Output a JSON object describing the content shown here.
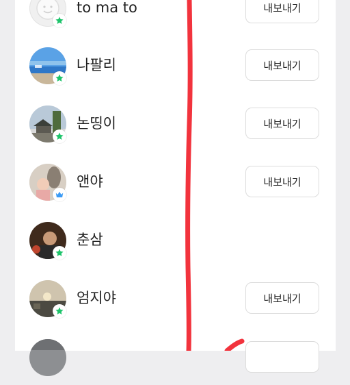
{
  "colors": {
    "background": "#eeeef0",
    "panel": "#ffffff",
    "badge_green": "#1ec46b",
    "badge_blue": "#3b9bf5",
    "annotation_red": "#f2333d"
  },
  "friends": [
    {
      "name": "to ma to",
      "badge": "star-green",
      "export_label": "내보내기"
    },
    {
      "name": "나팔리",
      "badge": "star-green",
      "export_label": "내보내기"
    },
    {
      "name": "논띵이",
      "badge": "star-green",
      "export_label": "내보내기"
    },
    {
      "name": "앤야",
      "badge": "crown-blue",
      "export_label": "내보내기"
    },
    {
      "name": "춘삼",
      "badge": "star-green",
      "export_label": ""
    },
    {
      "name": "엄지야",
      "badge": "star-green",
      "export_label": "내보내기"
    },
    {
      "name": "",
      "badge": "",
      "export_label": ""
    }
  ]
}
